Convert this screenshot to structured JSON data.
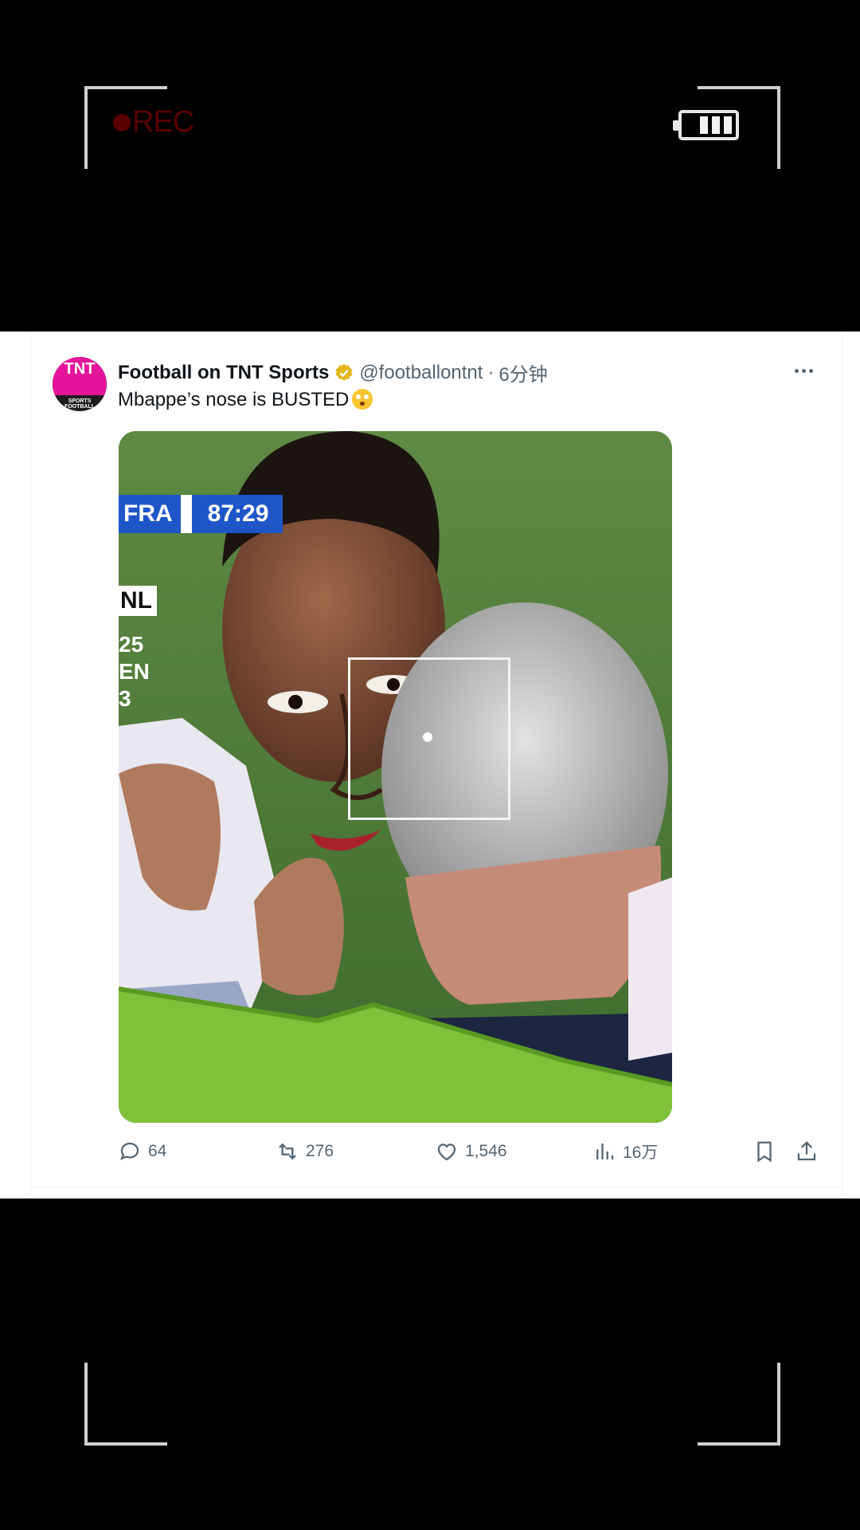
{
  "overlay": {
    "rec_label": "REC",
    "rec_color": "#5a0000",
    "battery_icon": "battery-icon"
  },
  "tweet": {
    "author_name": "Football on TNT Sports",
    "avatar_text": "TNT",
    "avatar_subtext": "SPORTS FOOTBALL",
    "handle": "@footballontnt",
    "separator": "·",
    "time": "6分钟",
    "text": "Mbappe’s nose is BUSTED",
    "emoji": "flushed-face-emoji",
    "media": {
      "scorebug_team": "FRA",
      "scorebug_time": "87:29",
      "side_label_1": "NL",
      "side_label_2": "25",
      "side_label_3": "EN",
      "side_label_4": "3"
    },
    "stats": {
      "replies": "64",
      "retweets": "276",
      "likes": "1,546",
      "views": "16万"
    }
  },
  "colors": {
    "brand_pink": "#e4149c",
    "verified_gold": "#e2b719",
    "muted_text": "#536471",
    "scorebug_blue": "#1e56c8"
  }
}
